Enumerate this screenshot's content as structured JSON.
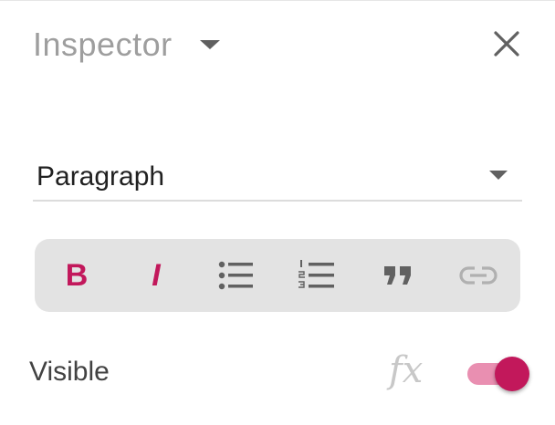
{
  "header": {
    "title": "Inspector",
    "title_dropdown_icon": "chevron-down-icon",
    "close_icon": "close-icon"
  },
  "block_type_select": {
    "value": "Paragraph",
    "dropdown_icon": "chevron-down-icon"
  },
  "toolbar": {
    "buttons": [
      {
        "name": "bold",
        "glyph": "B",
        "icon": "bold-icon"
      },
      {
        "name": "italic",
        "glyph": "I",
        "icon": "italic-icon"
      },
      {
        "name": "bulleted-list",
        "icon": "bulleted-list-icon"
      },
      {
        "name": "numbered-list",
        "icon": "numbered-list-icon"
      },
      {
        "name": "quote",
        "icon": "quote-icon"
      },
      {
        "name": "link",
        "icon": "link-icon"
      }
    ]
  },
  "visible_row": {
    "label": "Visible",
    "formula_icon": "fx-icon",
    "formula_glyph": "fx",
    "toggle_on": true
  },
  "colors": {
    "accent": "#c2185b",
    "accent_light": "#e98fb1",
    "toolbar_bg": "#e3e3e3",
    "muted_text": "#9e9e9e"
  }
}
